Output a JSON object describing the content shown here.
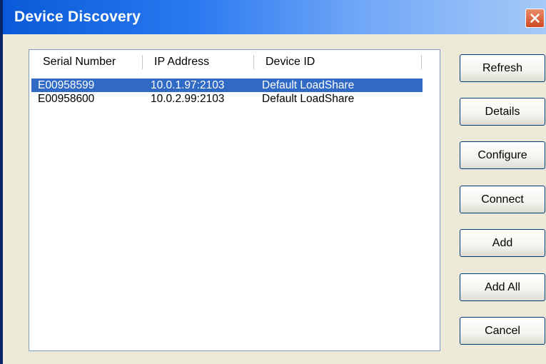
{
  "window": {
    "title": "Device Discovery"
  },
  "list": {
    "columns": [
      "Serial Number",
      "IP Address",
      "Device ID"
    ],
    "rows": [
      {
        "serial": "E00958599",
        "ip": "10.0.1.97:2103",
        "device_id": "Default LoadShare",
        "selected": true
      },
      {
        "serial": "E00958600",
        "ip": "10.0.2.99:2103",
        "device_id": "Default LoadShare",
        "selected": false
      }
    ]
  },
  "buttons": {
    "refresh": "Refresh",
    "details": "Details",
    "configure": "Configure",
    "connect": "Connect",
    "add": "Add",
    "add_all": "Add All",
    "cancel": "Cancel"
  },
  "colors": {
    "selection": "#316ac5",
    "titlebar_start": "#0a59d8",
    "dialog_bg": "#ece9d8",
    "close_button": "#d04a22"
  },
  "icons": {
    "close": "close-icon"
  }
}
